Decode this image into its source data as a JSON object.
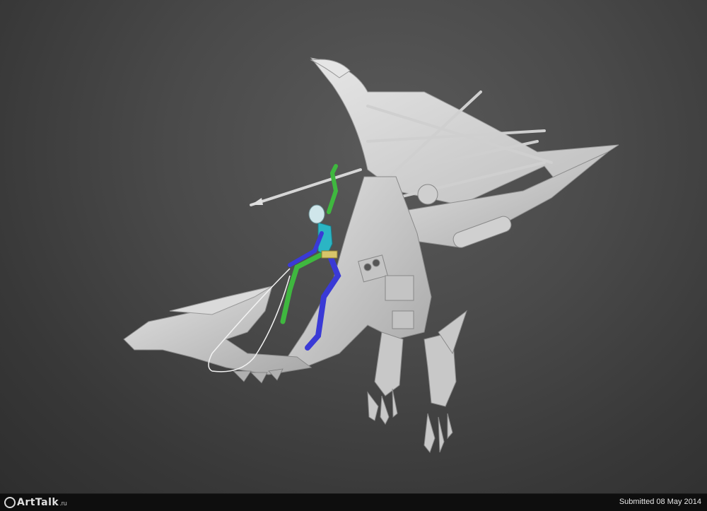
{
  "render": {
    "subject": "3D mechanical dragon with rider in viewport"
  },
  "footer": {
    "logo_text": "ArtTalk",
    "logo_suffix": ".ru",
    "submitted_label": "Submitted 08 May 2014"
  },
  "colors": {
    "background": "#454545",
    "model": "#d2d2d2",
    "rider_blue": "#3a3ad6",
    "rider_green": "#3fb83f",
    "rider_cyan": "#2bb5c4",
    "logo_accent": "#f08a1c"
  }
}
